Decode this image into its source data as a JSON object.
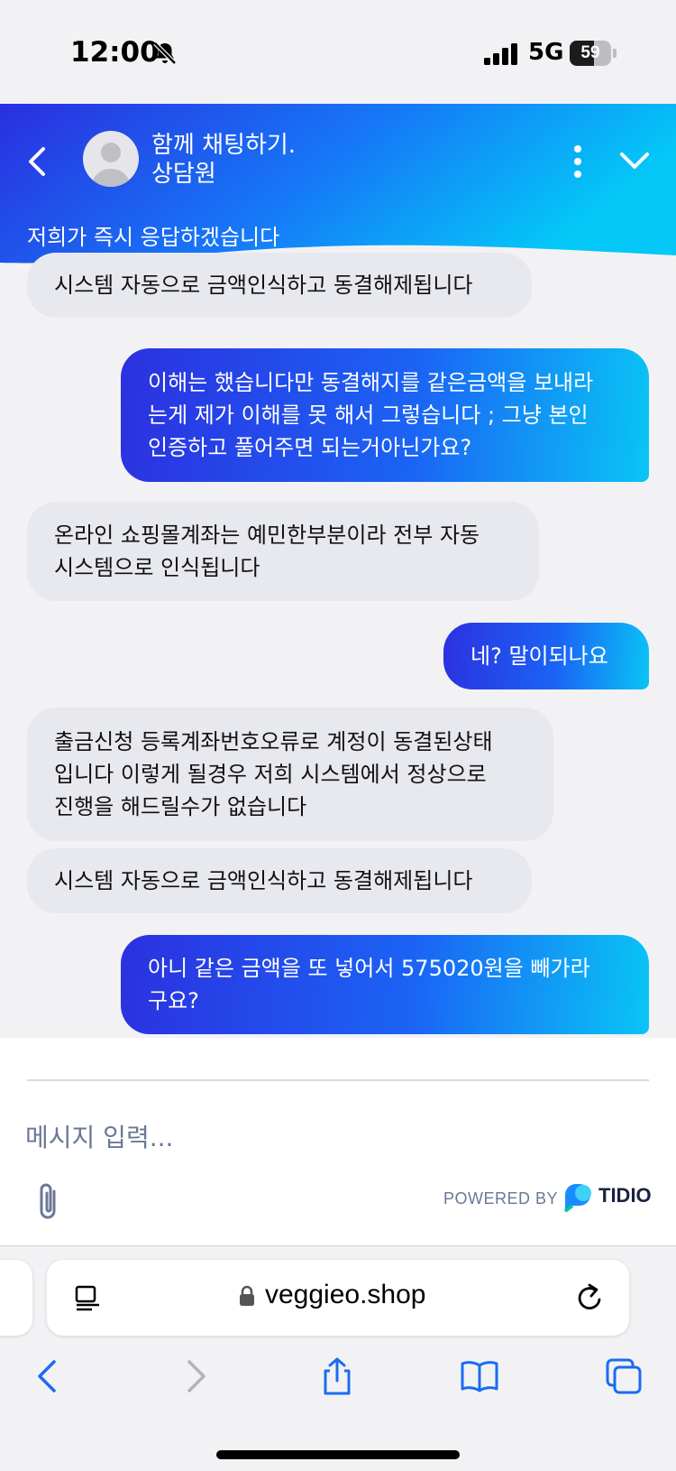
{
  "status_bar": {
    "time": "12:00",
    "network": "5G",
    "battery": "59",
    "battery_level": 0.59
  },
  "header": {
    "title_line1": "함께 채팅하기.",
    "title_line2": "상담원",
    "subtitle": "저희가 즉시 응답하겠습니다"
  },
  "messages": [
    {
      "sender": "operator",
      "text": "시스템 자동으로 금액인식하고 동결해제됩니다"
    },
    {
      "sender": "visitor",
      "text": "이해는 했습니다만 동결해지를 같은금액을 보내라\n는게 제가 이해를 못 해서 그렇습니다 ; 그냥 본인\n인증하고 풀어주면 되는거아닌가요?"
    },
    {
      "sender": "operator",
      "text": "온라인 쇼핑몰계좌는 예민한부분이라 전부 자동\n시스템으로 인식됩니다"
    },
    {
      "sender": "visitor",
      "text": "네? 말이되나요"
    },
    {
      "sender": "operator",
      "text": "출금신청 등록계좌번호오류로 계정이 동결된상태\n입니다 이렇게 될경우 저희 시스템에서 정상으로\n진행을 해드릴수가 없습니다"
    },
    {
      "sender": "operator",
      "text": "시스템 자동으로 금액인식하고 동결해제됩니다"
    },
    {
      "sender": "visitor",
      "text": "아니 같은 금액을 또 넣어서 575020원을 빼가라\n구요?"
    }
  ],
  "composer": {
    "placeholder": "메시지 입력...",
    "powered_by": "POWERED BY",
    "brand": "TIDIO"
  },
  "browser": {
    "url": "veggieo.shop"
  },
  "colors": {
    "header_start": "#2a2fe0",
    "header_end": "#04c8f7",
    "operator_bubble": "#e8e9ef",
    "tidio_blue": "#1a8cff"
  }
}
